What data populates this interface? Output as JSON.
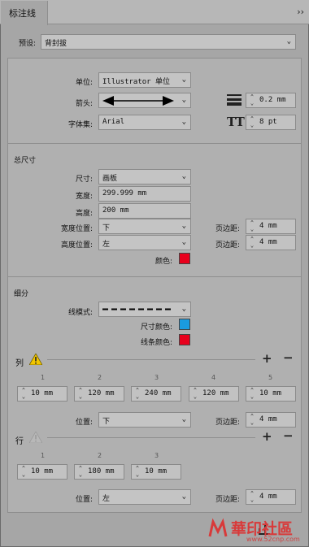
{
  "panel": {
    "tab_title": "标注线",
    "collapse_icon": "double-chevron-right-icon"
  },
  "preset": {
    "label": "预设:",
    "value": "背封拔"
  },
  "general": {
    "unit_label": "单位:",
    "unit_value": "Illustrator 单位",
    "arrow_label": "箭头:",
    "font_label": "字体集:",
    "font_value": "Arial",
    "line_weight": "0.2 mm",
    "font_size": "8 pt"
  },
  "total_size": {
    "heading": "总尺寸",
    "size_label": "尺寸:",
    "size_value": "画板",
    "width_label": "宽度:",
    "width_value": "299.999 mm",
    "height_label": "高度:",
    "height_value": "200 mm",
    "width_pos_label": "宽度位置:",
    "width_pos_value": "下",
    "height_pos_label": "高度位置:",
    "height_pos_value": "左",
    "margin_label": "页边距:",
    "width_margin": "4 mm",
    "height_margin": "4 mm",
    "color_label": "颜色:",
    "color": "#e8001c"
  },
  "subdivide": {
    "heading": "细分",
    "line_style_label": "线模式:",
    "size_color_label": "尺寸颜色:",
    "size_color": "#1a9be0",
    "line_color_label": "线条颜色:",
    "line_color": "#e8001c"
  },
  "columns": {
    "heading": "列",
    "numbers": [
      "1",
      "2",
      "3",
      "4",
      "5"
    ],
    "values": [
      "10 mm",
      "120 mm",
      "240 mm",
      "120 mm",
      "10 mm"
    ],
    "pos_label": "位置:",
    "pos_value": "下",
    "margin_label": "页边距:",
    "margin_value": "4 mm"
  },
  "rows": {
    "heading": "行",
    "numbers": [
      "1",
      "2",
      "3"
    ],
    "values": [
      "10 mm",
      "180 mm",
      "10 mm"
    ],
    "pos_label": "位置:",
    "pos_value": "左",
    "margin_label": "页边距:",
    "margin_value": "4 mm"
  },
  "watermark": {
    "text": "華印社區",
    "sub": "www.52cnp.com"
  }
}
